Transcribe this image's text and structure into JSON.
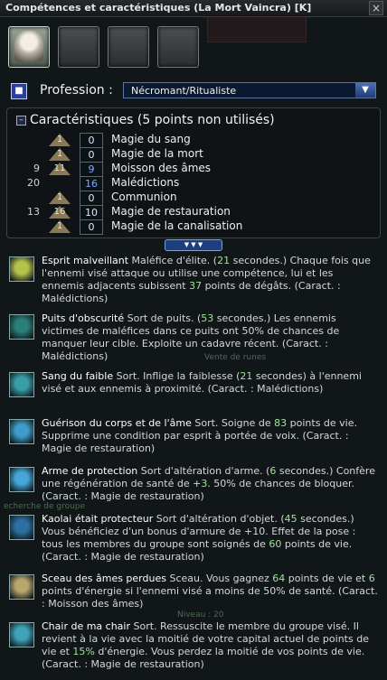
{
  "window": {
    "title": "Compétences et caractéristiques (La Mort Vaincra)  [K]",
    "close_label": "×"
  },
  "profession": {
    "label": "Profession :",
    "value": "Nécromant/Ritualiste"
  },
  "attributes": {
    "header": "Caractéristiques (5 points non utilisés)",
    "rows": [
      {
        "rank": "",
        "cost": "1",
        "value": "0",
        "name": "Magie du sang"
      },
      {
        "rank": "",
        "cost": "1",
        "value": "0",
        "name": "Magie de la mort"
      },
      {
        "rank": "9",
        "cost": "11",
        "value": "9",
        "name": "Moisson des âmes"
      },
      {
        "rank": "20",
        "cost": "",
        "value": "16",
        "name": "Malédictions"
      },
      {
        "rank": "",
        "cost": "1",
        "value": "0",
        "name": "Communion"
      },
      {
        "rank": "13",
        "cost": "16",
        "value": "10",
        "name": "Magie de restauration"
      },
      {
        "rank": "",
        "cost": "1",
        "value": "0",
        "name": "Magie de la canalisation"
      }
    ]
  },
  "skills": [
    {
      "name": "Esprit malveillant",
      "parts": [
        "Maléfice d'élite. (",
        "21",
        " secondes.) Chaque fois que l'ennemi visé attaque ou utilise une compétence, lui et les ennemis adjacents subissent ",
        "37",
        " points de dégâts. (Caract. : Malédictions)"
      ],
      "icon_color": "#b5c24a"
    },
    {
      "name": "Puits d'obscurité",
      "parts": [
        "Sort de puits. (",
        "53",
        " secondes.) Les ennemis victimes de maléfices dans ce puits ont 50% de chances de manquer leur cible. Exploite un cadavre récent. (Caract. : Malédictions)"
      ],
      "icon_color": "#2a7f7a"
    },
    {
      "name": "Sang du faible",
      "parts": [
        "Sort. Inflige la faiblesse (",
        "21",
        " secondes) à l'ennemi visé et aux ennemis à proximité. (Caract. : Malédictions)"
      ],
      "icon_color": "#3a9ea7"
    },
    {
      "name": "Guérison du corps et de l'âme",
      "parts": [
        "Sort. Soigne de ",
        "83",
        " points de vie. Supprime une condition par esprit à portée de voix. (Caract. : Magie de restauration)"
      ],
      "icon_color": "#3f9bc7"
    },
    {
      "name": "Arme de protection",
      "parts": [
        "Sort d'altération d'arme. (",
        "6",
        " secondes.) Confère une régénération de santé de +",
        "3",
        ". 50% de chances de bloquer. (Caract. : Magie de restauration)"
      ],
      "icon_color": "#46a6d8"
    },
    {
      "name": "Kaolai était protecteur",
      "parts": [
        "Sort d'altération d'objet. (",
        "45",
        " secondes.) Vous bénéficiez d'un bonus d'armure de +10. Effet de la pose : tous les membres du groupe sont soignés de ",
        "60",
        " points de vie. (Caract. : Magie de restauration)"
      ],
      "icon_color": "#2d6fa0"
    },
    {
      "name": "Sceau des âmes perdues",
      "parts": [
        "Sceau. Vous gagnez ",
        "64",
        " points de vie et ",
        "6",
        " points d'énergie si l'ennemi visé a moins de 50% de santé. (Caract. : Moisson des âmes)"
      ],
      "icon_color": "#bba66b"
    },
    {
      "name": "Chair de ma chair",
      "parts": [
        "Sort. Ressuscite le membre du groupe visé. Il revient à la vie avec la moitié de votre capital actuel de points de vie et ",
        "15%",
        " d'énergie. Vous perdez la moitié de vos points de vie. (Caract. : Magie de restauration)"
      ],
      "icon_color": "#3fa3b7"
    }
  ],
  "background": {
    "ghost_text_1": "Vente de runes",
    "ghost_text_2": "Niveau : 20",
    "ghost_text_3": "echerche de groupe"
  },
  "colors": {
    "accent_blue": "#1d3f7b",
    "value_green": "#9ee59b",
    "panel_bg": "#111618"
  }
}
